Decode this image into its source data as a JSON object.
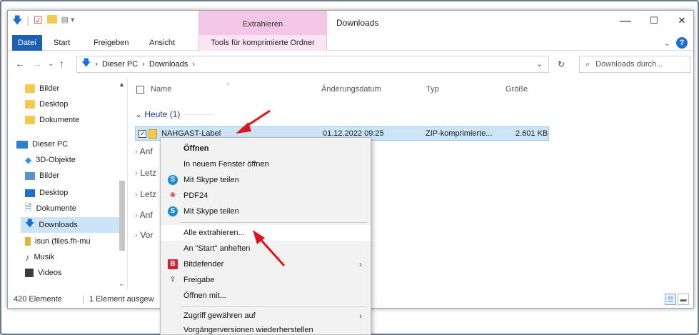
{
  "title_bar": {
    "contextual_tab_title": "Extrahieren",
    "window_title": "Downloads",
    "minimize": "—",
    "maximize": "☐",
    "close": "✕"
  },
  "ribbon": {
    "tabs": [
      "Datei",
      "Start",
      "Freigeben",
      "Ansicht",
      "Tools für komprimierte Ordner"
    ]
  },
  "address_bar": {
    "path": [
      "Dieser PC",
      "Downloads"
    ],
    "search_placeholder": "Downloads durch..."
  },
  "nav_pane": {
    "items": [
      "Bilder",
      "Desktop",
      "Dokumente",
      "Dieser PC",
      "3D-Objekte",
      "Bilder",
      "Desktop",
      "Dokumente",
      "Downloads",
      "isun (files.fh-mu",
      "Musik",
      "Videos"
    ]
  },
  "columns": {
    "name": "Name",
    "date": "Änderungsdatum",
    "type": "Typ",
    "size": "Größe"
  },
  "groups": [
    "Heute (1)",
    "Anf",
    "Letz",
    "Letz",
    "Anf",
    "Vor"
  ],
  "file": {
    "name": "NAHGAST-Label",
    "date": "01.12.2022 09:25",
    "type": "ZIP-komprimierte...",
    "size": "2.601 KB"
  },
  "status_bar": {
    "count": "420 Elemente",
    "selected": "1 Element ausgew"
  },
  "context_menu": {
    "items": [
      "Öffnen",
      "In neuem Fenster öffnen",
      "Mit Skype teilen",
      "PDF24",
      "Mit Skype teilen",
      "Alle extrahieren...",
      "An \"Start\" anheften",
      "Bitdefender",
      "Freigabe",
      "Öffnen mit...",
      "Zugriff gewähren auf",
      "Vorgängerversionen wiederherstellen"
    ]
  },
  "colors": {
    "accent": "#1d5fb5",
    "selection": "#cce4f7",
    "context_tab": "#f4c6e6",
    "annotation_arrow": "#e0141e"
  }
}
